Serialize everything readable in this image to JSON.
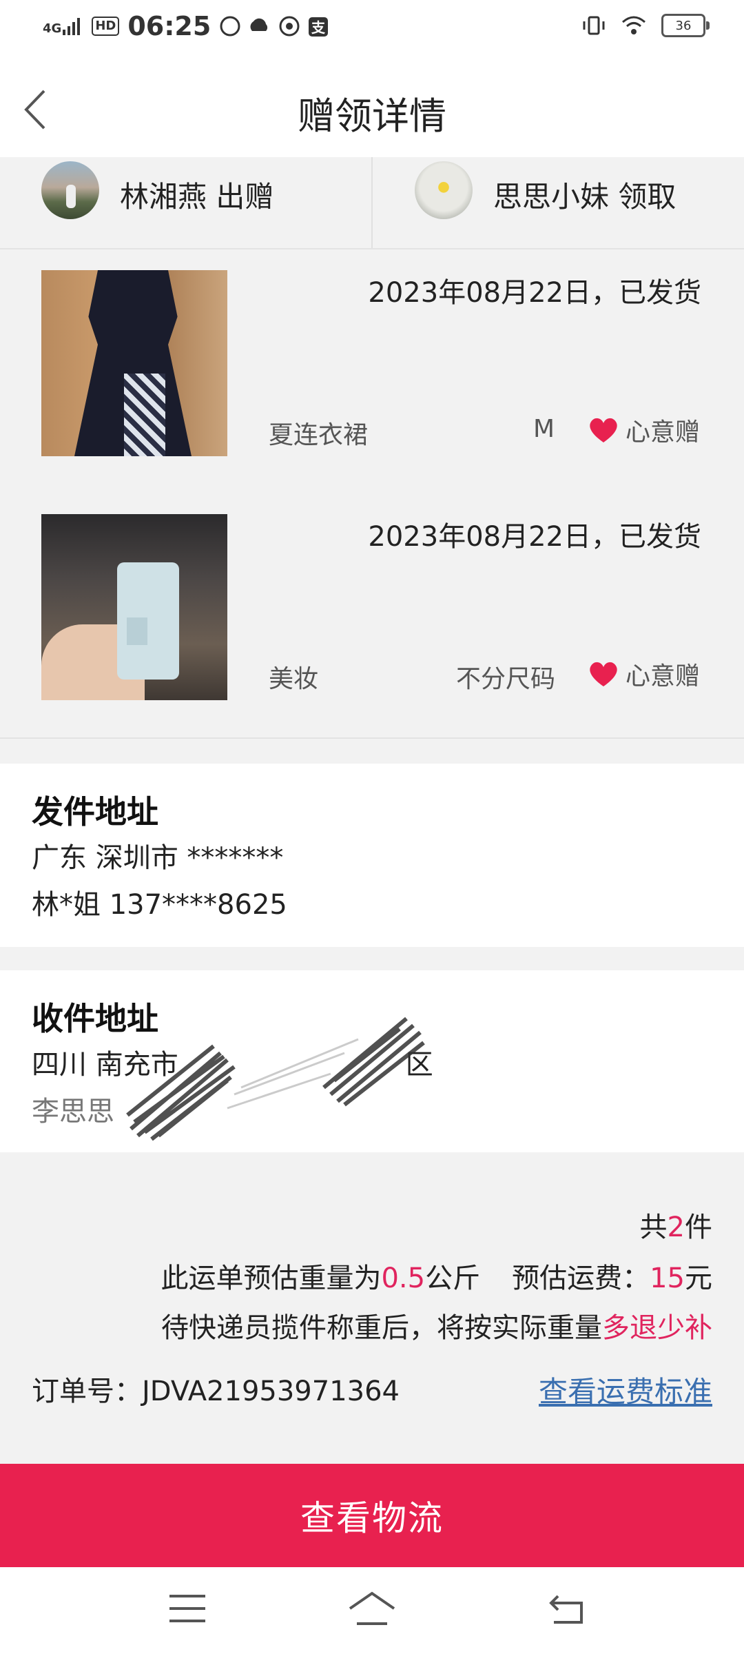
{
  "status_bar": {
    "network": "4G",
    "hd": "HD",
    "time": "06:25",
    "battery": "36"
  },
  "header": {
    "title": "赠领详情"
  },
  "parties": {
    "giver": "林湘燕 出赠",
    "receiver": "思思小妹 领取"
  },
  "items": [
    {
      "date_status": "2023年08月22日，已发货",
      "category": "夏连衣裙",
      "size": "M",
      "tag": "心意赠"
    },
    {
      "date_status": "2023年08月22日，已发货",
      "category": "美妆",
      "size": "不分尺码",
      "tag": "心意赠"
    }
  ],
  "sender_address": {
    "title": "发件地址",
    "region": "广东 深圳市 *******",
    "contact": "林*姐 137****8625"
  },
  "receiver_address": {
    "title": "收件地址",
    "region": "四川 南充市",
    "region_suffix": "区",
    "contact": "李思思"
  },
  "summary": {
    "count_prefix": "共",
    "count": "2",
    "count_suffix": "件",
    "weight_prefix": "此运单预估重量为",
    "weight": "0.5",
    "weight_unit": "公斤",
    "fee_prefix": "预估运费：",
    "fee": "15",
    "fee_unit": "元",
    "note_prefix": "待快递员揽件称重后，将按实际重量",
    "note_highlight": "多退少补",
    "order_no": "订单号：JDVA21953971364",
    "fee_link": "查看运费标准"
  },
  "cta": {
    "label": "查看物流"
  },
  "colors": {
    "accent": "#e8214f",
    "highlight": "#e0245e",
    "link": "#3a6fb0"
  }
}
